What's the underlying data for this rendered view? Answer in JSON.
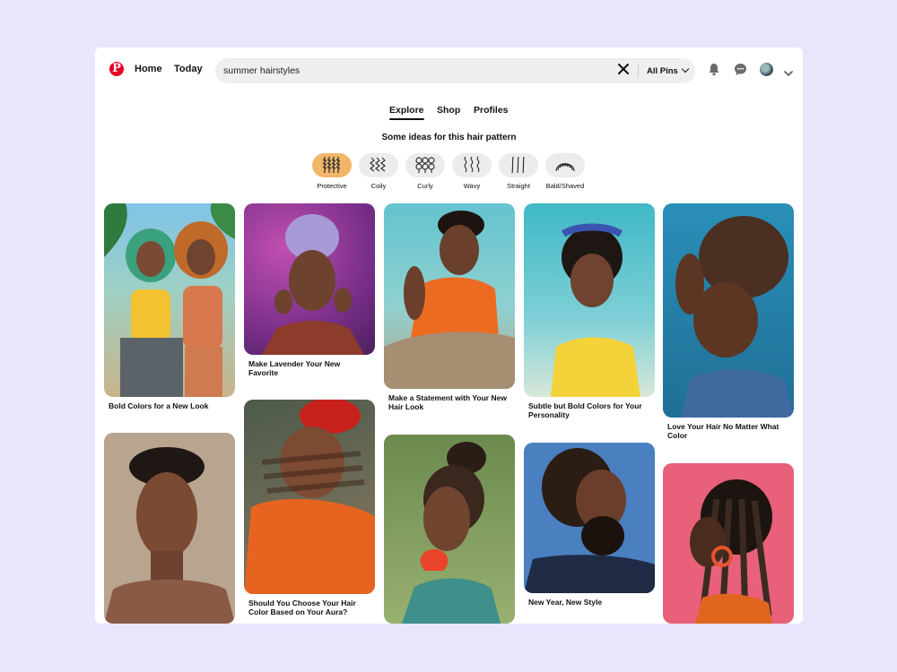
{
  "header": {
    "logo_letter": "P",
    "nav": {
      "home": "Home",
      "today": "Today"
    },
    "search_value": "summer hairstyles",
    "filter_label": "All Pins",
    "icons": {
      "clear": "close-icon",
      "bell": "bell-icon",
      "chat": "chat-icon",
      "account": "chevron-down-icon"
    }
  },
  "tabs": [
    "Explore",
    "Shop",
    "Profiles"
  ],
  "ideas": {
    "title": "Some ideas for this hair pattern",
    "chips": [
      {
        "label": "Protective",
        "selected": true
      },
      {
        "label": "Coily",
        "selected": false
      },
      {
        "label": "Curly",
        "selected": false
      },
      {
        "label": "Wavy",
        "selected": false
      },
      {
        "label": "Straight",
        "selected": false
      },
      {
        "label": "Bald/Shaved",
        "selected": false
      }
    ]
  },
  "pins": [
    {
      "title": "Bold Colors for a New Look"
    },
    {
      "title": "Make Lavender Your New Favorite"
    },
    {
      "title": "Make a Statement with Your New Hair Look"
    },
    {
      "title": "Subtle but Bold Colors for Your Personality"
    },
    {
      "title": "Love Your Hair No Matter What Color"
    },
    {
      "title": ""
    },
    {
      "title": "Should You Choose Your Hair Color Based on Your Aura?"
    },
    {
      "title": ""
    },
    {
      "title": "New Year, New Style"
    },
    {
      "title": ""
    }
  ],
  "colors": {
    "brand": "#e60023",
    "selected_chip": "#f2b66a",
    "page_background": "#e9e5fb"
  }
}
